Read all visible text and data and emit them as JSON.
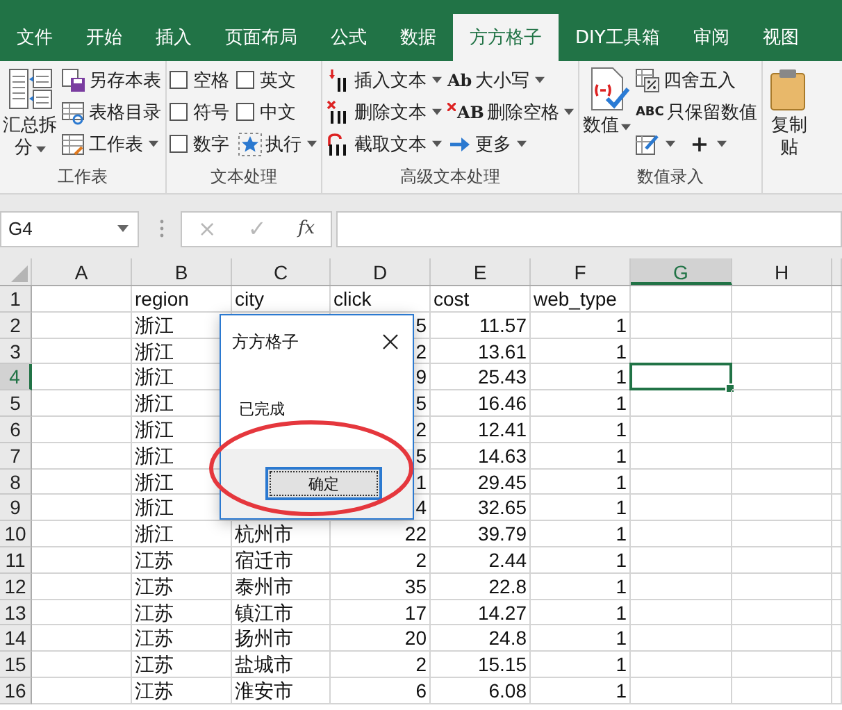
{
  "tabs": [
    {
      "label": "文件",
      "selected": false
    },
    {
      "label": "开始",
      "selected": false
    },
    {
      "label": "插入",
      "selected": false
    },
    {
      "label": "页面布局",
      "selected": false
    },
    {
      "label": "公式",
      "selected": false
    },
    {
      "label": "数据",
      "selected": false
    },
    {
      "label": "方方格子",
      "selected": true
    },
    {
      "label": "DIY工具箱",
      "selected": false
    },
    {
      "label": "审阅",
      "selected": false
    },
    {
      "label": "视图",
      "selected": false
    }
  ],
  "ribbon_groups": [
    {
      "label": "工作表",
      "columns": [
        [
          [
            {
              "kind": "large",
              "lines": [
                "汇总拆",
                "分"
              ],
              "dropdown": true
            }
          ]
        ],
        [
          [
            {
              "kind": "button",
              "label": "另存本表",
              "dropdown": false
            }
          ],
          [
            {
              "kind": "button",
              "label": "表格目录",
              "dropdown": false
            }
          ],
          [
            {
              "kind": "button",
              "label": "工作表",
              "dropdown": true
            }
          ]
        ]
      ]
    },
    {
      "label": "文本处理",
      "columns": [
        [
          [
            {
              "kind": "checkbox",
              "label": "空格",
              "checked": false
            }
          ],
          [
            {
              "kind": "checkbox",
              "label": "符号",
              "checked": false
            }
          ],
          [
            {
              "kind": "checkbox",
              "label": "数字",
              "checked": false
            }
          ]
        ],
        [
          [
            {
              "kind": "checkbox",
              "label": "英文",
              "checked": false
            }
          ],
          [
            {
              "kind": "checkbox",
              "label": "中文",
              "checked": false
            }
          ],
          [
            {
              "kind": "button",
              "label": "执行",
              "dropdown": true
            }
          ]
        ]
      ]
    },
    {
      "label": "高级文本处理",
      "columns": [
        [
          [
            {
              "kind": "button",
              "label": "插入文本",
              "dropdown": true
            }
          ],
          [
            {
              "kind": "button",
              "label": "删除文本",
              "dropdown": true
            }
          ],
          [
            {
              "kind": "button",
              "label": "截取文本",
              "dropdown": true
            }
          ]
        ],
        [
          [
            {
              "kind": "button",
              "icon_text": "Ab",
              "label": "大小写",
              "dropdown": true
            }
          ],
          [
            {
              "kind": "button",
              "icon_text": "AB",
              "label": "删除空格",
              "dropdown": true
            }
          ],
          [
            {
              "kind": "button",
              "label": "更多",
              "dropdown": true
            }
          ]
        ]
      ]
    },
    {
      "label": "数值录入",
      "columns": [
        [
          [
            {
              "kind": "large",
              "lines": [
                "数值"
              ],
              "dropdown": true
            }
          ]
        ],
        [
          [
            {
              "kind": "button",
              "label": "四舍五入",
              "dropdown": false
            }
          ],
          [
            {
              "kind": "button",
              "icon_text": "ABC",
              "label": "只保留数值",
              "dropdown": false
            }
          ],
          [
            {
              "kind": "button",
              "dropdown": true
            },
            {
              "kind": "button",
              "icon_text": "+",
              "dropdown": true
            }
          ]
        ]
      ]
    },
    {
      "columns": [
        [
          [
            {
              "kind": "large",
              "lines": [
                "复制",
                "贴"
              ],
              "dropdown": false
            }
          ]
        ]
      ]
    }
  ],
  "formula_bar": {
    "name_box": "G4",
    "cancel": "×",
    "enter": "✓",
    "function": "fx"
  },
  "columns": [
    {
      "label": "A",
      "selected": false
    },
    {
      "label": "B",
      "selected": false
    },
    {
      "label": "C",
      "selected": false
    },
    {
      "label": "D",
      "selected": false
    },
    {
      "label": "E",
      "selected": false
    },
    {
      "label": "F",
      "selected": false
    },
    {
      "label": "G",
      "selected": true
    },
    {
      "label": "H",
      "selected": false
    }
  ],
  "rows": [
    {
      "number": "1",
      "selected": false,
      "cells": {
        "B": "region",
        "C": "city",
        "D": "click",
        "E": "cost",
        "F": "web_type"
      },
      "numbers": {}
    },
    {
      "number": "2",
      "selected": false,
      "cells": {
        "B": "浙江"
      },
      "numbers": {
        "D": "5",
        "E": "11.57",
        "F": "1"
      }
    },
    {
      "number": "3",
      "selected": false,
      "cells": {
        "B": "浙江"
      },
      "numbers": {
        "D": "2",
        "E": "13.61",
        "F": "1"
      }
    },
    {
      "number": "4",
      "selected": true,
      "cells": {
        "B": "浙江"
      },
      "numbers": {
        "D": "9",
        "E": "25.43",
        "F": "1"
      }
    },
    {
      "number": "5",
      "selected": false,
      "cells": {
        "B": "浙江"
      },
      "numbers": {
        "D": "5",
        "E": "16.46",
        "F": "1"
      }
    },
    {
      "number": "6",
      "selected": false,
      "cells": {
        "B": "浙江"
      },
      "numbers": {
        "D": "2",
        "E": "12.41",
        "F": "1"
      }
    },
    {
      "number": "7",
      "selected": false,
      "cells": {
        "B": "浙江"
      },
      "numbers": {
        "D": "5",
        "E": "14.63",
        "F": "1"
      }
    },
    {
      "number": "8",
      "selected": false,
      "cells": {
        "B": "浙江"
      },
      "numbers": {
        "D": "1",
        "E": "29.45",
        "F": "1"
      }
    },
    {
      "number": "9",
      "selected": false,
      "cells": {
        "B": "浙江"
      },
      "numbers": {
        "D": "4",
        "E": "32.65",
        "F": "1"
      }
    },
    {
      "number": "10",
      "selected": false,
      "cells": {
        "B": "浙江",
        "C": "杭州市"
      },
      "numbers": {
        "D": "22",
        "E": "39.79",
        "F": "1"
      }
    },
    {
      "number": "11",
      "selected": false,
      "cells": {
        "B": "江苏",
        "C": "宿迁市"
      },
      "numbers": {
        "D": "2",
        "E": "2.44",
        "F": "1"
      }
    },
    {
      "number": "12",
      "selected": false,
      "cells": {
        "B": "江苏",
        "C": "泰州市"
      },
      "numbers": {
        "D": "35",
        "E": "22.8",
        "F": "1"
      }
    },
    {
      "number": "13",
      "selected": false,
      "cells": {
        "B": "江苏",
        "C": "镇江市"
      },
      "numbers": {
        "D": "17",
        "E": "14.27",
        "F": "1"
      }
    },
    {
      "number": "14",
      "selected": false,
      "cells": {
        "B": "江苏",
        "C": "扬州市"
      },
      "numbers": {
        "D": "20",
        "E": "24.8",
        "F": "1"
      }
    },
    {
      "number": "15",
      "selected": false,
      "cells": {
        "B": "江苏",
        "C": "盐城市"
      },
      "numbers": {
        "D": "2",
        "E": "15.15",
        "F": "1"
      }
    },
    {
      "number": "16",
      "selected": false,
      "cells": {
        "B": "江苏",
        "C": "淮安市"
      },
      "numbers": {
        "D": "6",
        "E": "6.08",
        "F": "1"
      }
    }
  ],
  "dialog": {
    "title": "方方格子",
    "message": "已完成",
    "button": "确定"
  }
}
